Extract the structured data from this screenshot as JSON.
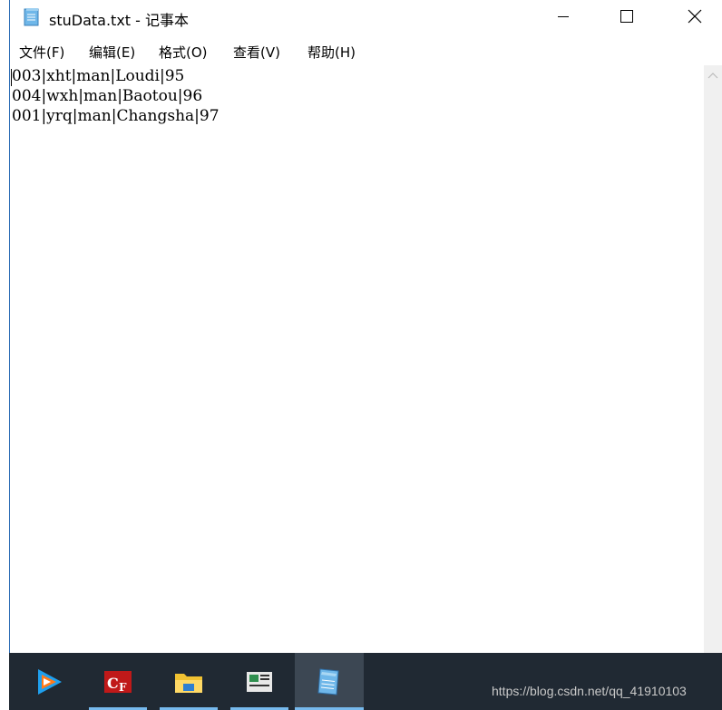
{
  "window": {
    "title": "stuData.txt - 记事本",
    "icon": "notepad-icon"
  },
  "controls": {
    "minimize": "minimize-icon",
    "maximize": "maximize-icon",
    "close": "close-icon"
  },
  "menu": {
    "items": [
      {
        "label": "文件(F)"
      },
      {
        "label": "编辑(E)"
      },
      {
        "label": "格式(O)"
      },
      {
        "label": "查看(V)"
      },
      {
        "label": "帮助(H)"
      }
    ]
  },
  "editor": {
    "lines": [
      "003|xht|man|Loudi|95",
      "004|wxh|man|Baotou|96",
      "001|yrq|man|Changsha|97"
    ]
  },
  "taskbar": {
    "items": [
      {
        "icon": "tencent-video-icon"
      },
      {
        "icon": "cf-game-icon"
      },
      {
        "icon": "file-explorer-icon"
      },
      {
        "icon": "news-app-icon"
      },
      {
        "icon": "notepad-icon"
      }
    ]
  },
  "watermark": {
    "text": "https://blog.csdn.net/qq_41910103"
  },
  "colors": {
    "taskbar_bg": "#202933",
    "accent": "#76b9ed"
  }
}
